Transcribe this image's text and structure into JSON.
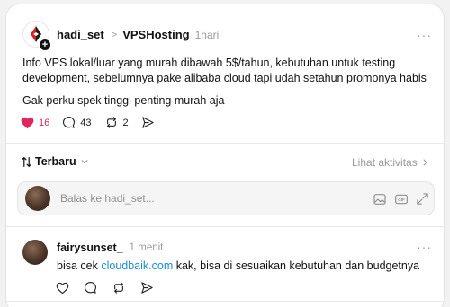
{
  "post": {
    "username": "hadi_set",
    "separator": ">",
    "community": "VPSHosting",
    "time": "1hari",
    "more": "···",
    "line1": "Info VPS lokal/luar yang murah dibawah 5$/tahun, kebutuhan untuk testing",
    "line2": "development, sebelumnya pake alibaba cloud tapi udah setahun promonya habis",
    "line3": "Gak perku spek tinggi penting murah aja",
    "likes": "16",
    "comments": "43",
    "reposts": "2"
  },
  "sort": {
    "label": "Terbaru",
    "activity_link": "Lihat aktivitas"
  },
  "reply": {
    "placeholder": "Balas ke hadi_set..."
  },
  "comment": {
    "username": "fairysunset_",
    "time": "1 menit",
    "more": "···",
    "text_before": "bisa cek ",
    "link": "cloudbaik.com",
    "text_after": " kak, bisa di sesuaikan kebutuhan dan budgetnya"
  },
  "colors": {
    "like_active": "#e0245e",
    "link": "#1a8cd8"
  }
}
